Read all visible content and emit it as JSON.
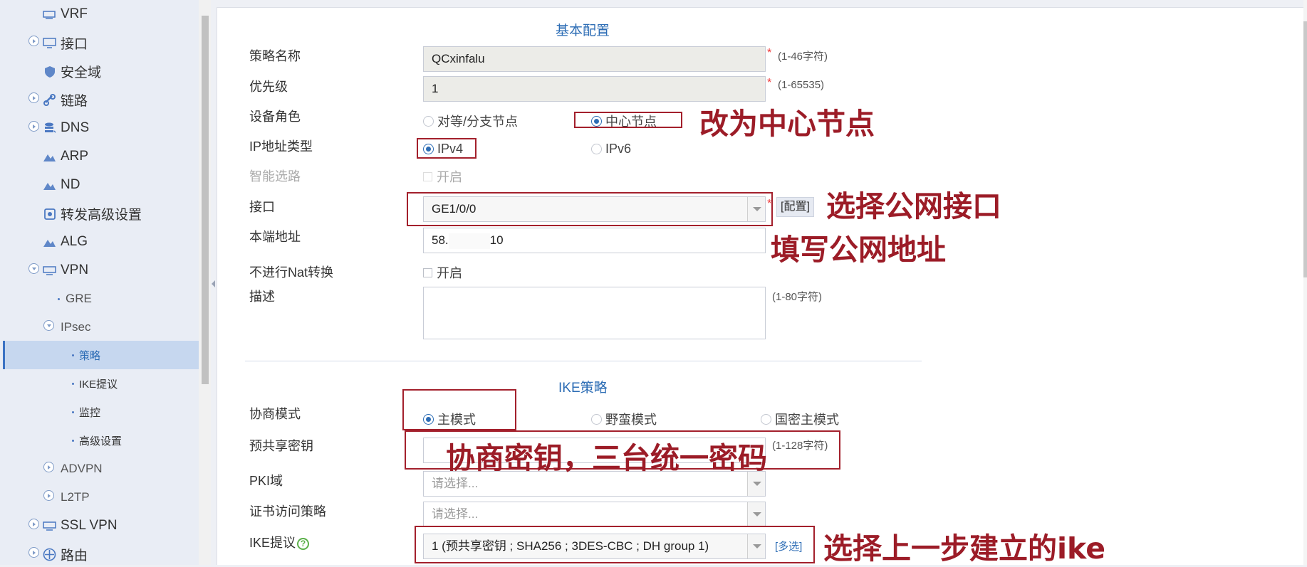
{
  "sidebar": {
    "items": [
      {
        "label": "VRF",
        "icon": "vrf-icon"
      },
      {
        "label": "接口",
        "icon": "interface-icon"
      },
      {
        "label": "安全域",
        "icon": "shield-icon"
      },
      {
        "label": "链路",
        "icon": "link-icon"
      },
      {
        "label": "DNS",
        "icon": "database-icon"
      },
      {
        "label": "ARP",
        "icon": "arp-icon"
      },
      {
        "label": "ND",
        "icon": "nd-icon"
      },
      {
        "label": "转发高级设置",
        "icon": "settings-icon"
      },
      {
        "label": "ALG",
        "icon": "alg-icon"
      },
      {
        "label": "VPN",
        "icon": "vpn-icon"
      },
      {
        "label": "GRE"
      },
      {
        "label": "IPsec"
      },
      {
        "label": "策略"
      },
      {
        "label": "IKE提议"
      },
      {
        "label": "监控"
      },
      {
        "label": "高级设置"
      },
      {
        "label": "ADVPN"
      },
      {
        "label": "L2TP"
      },
      {
        "label": "SSL VPN",
        "icon": "ssl-vpn-icon"
      },
      {
        "label": "路由",
        "icon": "route-icon"
      }
    ],
    "selected": "策略"
  },
  "basic": {
    "title": "基本配置",
    "policy_name_label": "策略名称",
    "policy_name_value": "QCxinfalu",
    "policy_name_hint": "(1-46字符)",
    "priority_label": "优先级",
    "priority_value": "1",
    "priority_hint": "(1-65535)",
    "role_label": "设备角色",
    "role_option_peer": "对等/分支节点",
    "role_option_center": "中心节点",
    "ip_type_label": "IP地址类型",
    "ip_option_v4": "IPv4",
    "ip_option_v6": "IPv6",
    "smart_route_label": "智能选路",
    "smart_route_option": "开启",
    "interface_label": "接口",
    "interface_value": "GE1/0/0",
    "config_button": "[配置]",
    "local_addr_label": "本端地址",
    "local_addr_prefix": "58.",
    "local_addr_suffix": "10",
    "nat_label": "不进行Nat转换",
    "nat_option": "开启",
    "desc_label": "描述",
    "desc_hint": "(1-80字符)",
    "required_mark": "*"
  },
  "ike": {
    "title": "IKE策略",
    "mode_label": "协商模式",
    "mode_main": "主模式",
    "mode_aggressive": "野蛮模式",
    "mode_gm": "国密主模式",
    "psk_label": "预共享密钥",
    "psk_hint": "(1-128字符)",
    "pki_label": "PKI域",
    "pki_placeholder": "请选择...",
    "cert_label": "证书访问策略",
    "cert_placeholder": "请选择...",
    "proposal_label": "IKE提议",
    "proposal_value": "1 (预共享密钥 ; SHA256 ; 3DES-CBC ; DH group 1)",
    "multi_select": "[多选]",
    "help_glyph": "?"
  },
  "annotations": {
    "center_node": "改为中心节点",
    "public_interface": "选择公网接口",
    "public_address": "填写公网地址",
    "psk": "协商密钥，三台统一密码",
    "ike_proposal": "选择上一步建立的ike"
  },
  "colors": {
    "accent": "#2d6db5",
    "annotation": "#9c1c27",
    "sidebar_bg": "#e9edf5",
    "selected_bg": "#c6d7ef"
  }
}
